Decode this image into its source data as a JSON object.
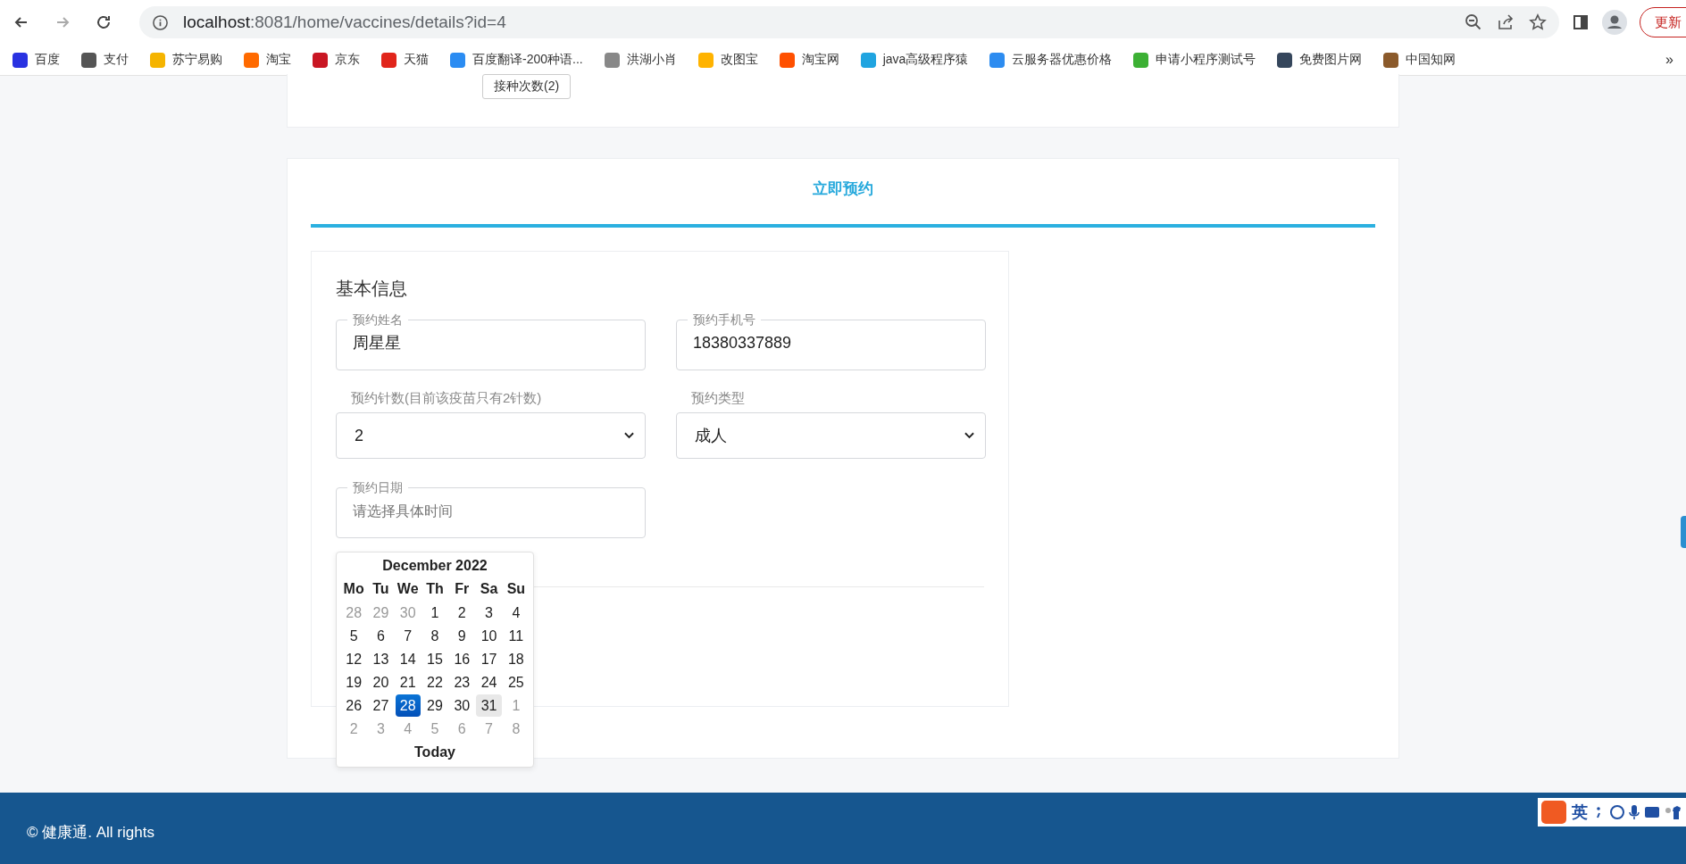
{
  "browser": {
    "url_host": "localhost",
    "url_path": ":8081/home/vaccines/details?id=4",
    "update_button": "更新",
    "bookmarks": [
      {
        "label": "百度",
        "color": "#2932e1"
      },
      {
        "label": "支付",
        "color": "#555555"
      },
      {
        "label": "苏宁易购",
        "color": "#f5b400"
      },
      {
        "label": "淘宝",
        "color": "#ff6a00"
      },
      {
        "label": "京东",
        "color": "#c91623"
      },
      {
        "label": "天猫",
        "color": "#e1251b"
      },
      {
        "label": "百度翻译-200种语...",
        "color": "#2b8cf2"
      },
      {
        "label": "洪湖小肖",
        "color": "#888888"
      },
      {
        "label": "改图宝",
        "color": "#ffb300"
      },
      {
        "label": "淘宝网",
        "color": "#ff5000"
      },
      {
        "label": "java高级程序猿",
        "color": "#20a4e0"
      },
      {
        "label": "云服务器优惠价格",
        "color": "#2d8cf0"
      },
      {
        "label": "申请小程序测试号",
        "color": "#3cb034"
      },
      {
        "label": "免费图片网",
        "color": "#35465c"
      },
      {
        "label": "中国知网",
        "color": "#8b5a2b"
      }
    ],
    "more_bookmarks": "»"
  },
  "top_card": {
    "tag": "接种次数(2)"
  },
  "booking": {
    "tab": "立即预约",
    "section_title": "基本信息",
    "fields": [
      {
        "kind": "text",
        "label": "预约姓名",
        "value": "周星星"
      },
      {
        "kind": "text",
        "label": "预约手机号",
        "value": "18380337889"
      },
      {
        "kind": "select",
        "label": "预约针数(目前该疫苗只有2针数)",
        "value": "2"
      },
      {
        "kind": "select",
        "label": "预约类型",
        "value": "成人"
      },
      {
        "kind": "text",
        "label": "预约日期",
        "placeholder": "请选择具体时间"
      }
    ]
  },
  "datepicker": {
    "title": "December 2022",
    "weekdays": [
      "Mo",
      "Tu",
      "We",
      "Th",
      "Fr",
      "Sa",
      "Su"
    ],
    "weeks": [
      [
        {
          "d": "28",
          "muted": true,
          "selected": false,
          "hovered": false
        },
        {
          "d": "29",
          "muted": true,
          "selected": false,
          "hovered": false
        },
        {
          "d": "30",
          "muted": true,
          "selected": false,
          "hovered": false
        },
        {
          "d": "1",
          "muted": false,
          "selected": false,
          "hovered": false
        },
        {
          "d": "2",
          "muted": false,
          "selected": false,
          "hovered": false
        },
        {
          "d": "3",
          "muted": false,
          "selected": false,
          "hovered": false
        },
        {
          "d": "4",
          "muted": false,
          "selected": false,
          "hovered": false
        }
      ],
      [
        {
          "d": "5",
          "muted": false,
          "selected": false,
          "hovered": false
        },
        {
          "d": "6",
          "muted": false,
          "selected": false,
          "hovered": false
        },
        {
          "d": "7",
          "muted": false,
          "selected": false,
          "hovered": false
        },
        {
          "d": "8",
          "muted": false,
          "selected": false,
          "hovered": false
        },
        {
          "d": "9",
          "muted": false,
          "selected": false,
          "hovered": false
        },
        {
          "d": "10",
          "muted": false,
          "selected": false,
          "hovered": false
        },
        {
          "d": "11",
          "muted": false,
          "selected": false,
          "hovered": false
        }
      ],
      [
        {
          "d": "12",
          "muted": false,
          "selected": false,
          "hovered": false
        },
        {
          "d": "13",
          "muted": false,
          "selected": false,
          "hovered": false
        },
        {
          "d": "14",
          "muted": false,
          "selected": false,
          "hovered": false
        },
        {
          "d": "15",
          "muted": false,
          "selected": false,
          "hovered": false
        },
        {
          "d": "16",
          "muted": false,
          "selected": false,
          "hovered": false
        },
        {
          "d": "17",
          "muted": false,
          "selected": false,
          "hovered": false
        },
        {
          "d": "18",
          "muted": false,
          "selected": false,
          "hovered": false
        }
      ],
      [
        {
          "d": "19",
          "muted": false,
          "selected": false,
          "hovered": false
        },
        {
          "d": "20",
          "muted": false,
          "selected": false,
          "hovered": false
        },
        {
          "d": "21",
          "muted": false,
          "selected": false,
          "hovered": false
        },
        {
          "d": "22",
          "muted": false,
          "selected": false,
          "hovered": false
        },
        {
          "d": "23",
          "muted": false,
          "selected": false,
          "hovered": false
        },
        {
          "d": "24",
          "muted": false,
          "selected": false,
          "hovered": false
        },
        {
          "d": "25",
          "muted": false,
          "selected": false,
          "hovered": false
        }
      ],
      [
        {
          "d": "26",
          "muted": false,
          "selected": false,
          "hovered": false
        },
        {
          "d": "27",
          "muted": false,
          "selected": false,
          "hovered": false
        },
        {
          "d": "28",
          "muted": false,
          "selected": true,
          "hovered": false
        },
        {
          "d": "29",
          "muted": false,
          "selected": false,
          "hovered": false
        },
        {
          "d": "30",
          "muted": false,
          "selected": false,
          "hovered": false
        },
        {
          "d": "31",
          "muted": false,
          "selected": false,
          "hovered": true
        },
        {
          "d": "1",
          "muted": true,
          "selected": false,
          "hovered": false
        }
      ],
      [
        {
          "d": "2",
          "muted": true,
          "selected": false,
          "hovered": false
        },
        {
          "d": "3",
          "muted": true,
          "selected": false,
          "hovered": false
        },
        {
          "d": "4",
          "muted": true,
          "selected": false,
          "hovered": false
        },
        {
          "d": "5",
          "muted": true,
          "selected": false,
          "hovered": false
        },
        {
          "d": "6",
          "muted": true,
          "selected": false,
          "hovered": false
        },
        {
          "d": "7",
          "muted": true,
          "selected": false,
          "hovered": false
        },
        {
          "d": "8",
          "muted": true,
          "selected": false,
          "hovered": false
        }
      ]
    ],
    "today_button": "Today"
  },
  "footer": {
    "text": "© 健康通. All rights"
  },
  "ime_toolbar": {
    "mode": "英"
  }
}
